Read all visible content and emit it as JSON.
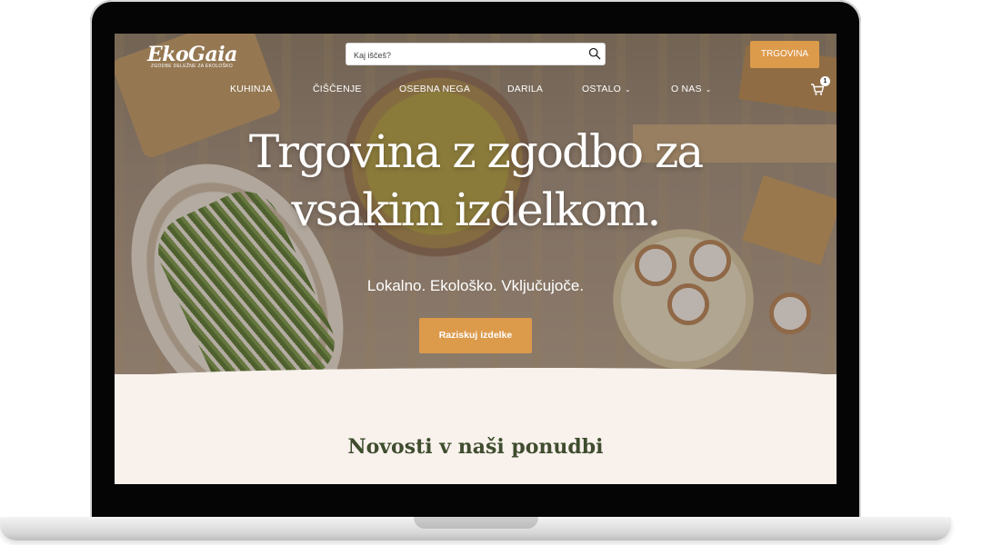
{
  "brand": {
    "logo_text": "EkoGaia",
    "tagline": "ZGODBE DELEŽNE ZA EKOLOŠKO"
  },
  "header": {
    "search_placeholder": "Kaj iščeš?",
    "shop_button": "TRGOVINA",
    "cart_count": "1"
  },
  "nav": {
    "items": [
      {
        "label": "KUHINJA"
      },
      {
        "label": "ČIŠČENJE"
      },
      {
        "label": "OSEBNA NEGA"
      },
      {
        "label": "DARILA"
      },
      {
        "label": "OSTALO"
      },
      {
        "label": "O NAS"
      }
    ]
  },
  "hero": {
    "title_line1": "Trgovina z zgodbo za",
    "title_line2": "vsakim izdelkom.",
    "subtitle": "Lokalno. Ekološko. Vključujoče.",
    "cta": "Raziskuj izdelke"
  },
  "section": {
    "title": "Novosti v naši ponudbi"
  },
  "colors": {
    "accent": "#dc9a4b",
    "section_bg": "#f8f1ec",
    "heading_green": "#3f4d2e"
  }
}
